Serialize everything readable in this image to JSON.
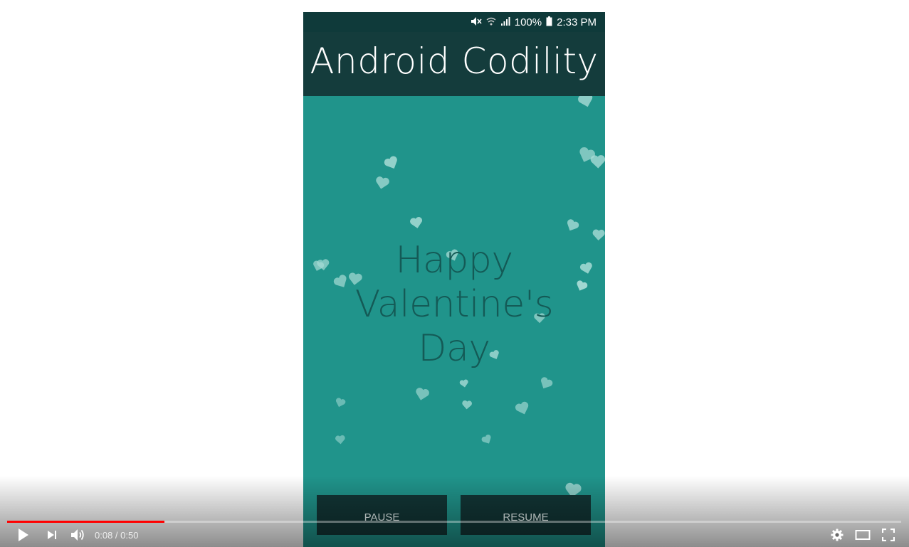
{
  "video_frame": {
    "status_bar": {
      "battery_percent": "100%",
      "time": "2:33 PM",
      "icons": [
        "mute-icon",
        "wifi-icon",
        "signal-icon",
        "battery-icon"
      ]
    },
    "app_title": "Android Codility",
    "message_line1": "Happy Valentine's",
    "message_line2": "Day",
    "pause_label": "PAUSE",
    "resume_label": "RESUME",
    "colors": {
      "background": "#20948b",
      "app_bar": "#143c3c",
      "status_bar": "#0f3a3a",
      "message_text": "#145a56",
      "hearts": "#a8dcd6"
    }
  },
  "player": {
    "progress_fraction": 0.176,
    "current_time": "0:08",
    "separator": " / ",
    "duration": "0:50",
    "controls": [
      "play-icon",
      "next-icon",
      "volume-icon",
      "settings-icon",
      "theater-mode-icon",
      "fullscreen-icon"
    ],
    "colors": {
      "progress": "#ff0000"
    }
  }
}
